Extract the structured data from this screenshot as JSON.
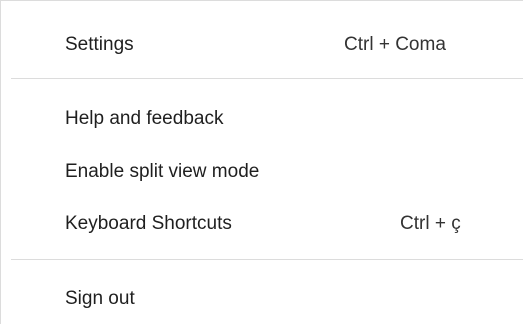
{
  "menu": {
    "items": [
      {
        "label": "Settings",
        "shortcut": "Ctrl + Coma"
      },
      {
        "label": "Help and feedback",
        "shortcut": ""
      },
      {
        "label": "Enable split view mode",
        "shortcut": ""
      },
      {
        "label": "Keyboard Shortcuts",
        "shortcut": "Ctrl + ç"
      },
      {
        "label": "Sign out",
        "shortcut": ""
      }
    ]
  }
}
